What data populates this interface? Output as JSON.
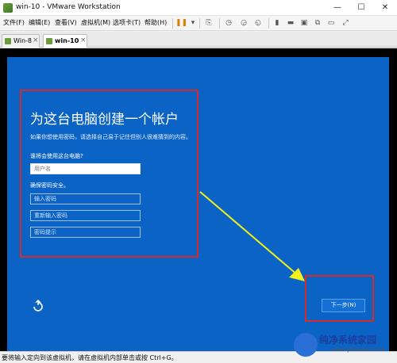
{
  "window": {
    "title": "win-10 - VMware Workstation"
  },
  "menu": [
    "文件(F)",
    "编辑(E)",
    "查看(V)",
    "虚拟机(M)",
    "选项卡(T)",
    "帮助(H)"
  ],
  "tabs": [
    {
      "label": "Win-8",
      "active": false
    },
    {
      "label": "win-10",
      "active": true
    }
  ],
  "oobe": {
    "heading": "为这台电脑创建一个帐户",
    "description": "如果你想使用密码，请选择自己易于记住但别人很难猜到的内容。",
    "who_label": "谁将会使用这台电脑?",
    "username_placeholder": "用户名",
    "security_label": "确保密码安全。",
    "password_placeholder": "输入密码",
    "reenter_placeholder": "重新输入密码",
    "hint_placeholder": "密码提示",
    "next_button": "下一步(N)"
  },
  "status": {
    "text": "要将输入定向到该虚拟机，请在虚拟机内部单击或按 Ctrl+G。"
  },
  "watermark": {
    "title": "纯净系统家园",
    "url": "www.yidaimei.com"
  },
  "colors": {
    "oobe_blue": "#0a63c5",
    "highlight_red": "#d62b2b",
    "arrow_yellow": "#f2f21a"
  }
}
